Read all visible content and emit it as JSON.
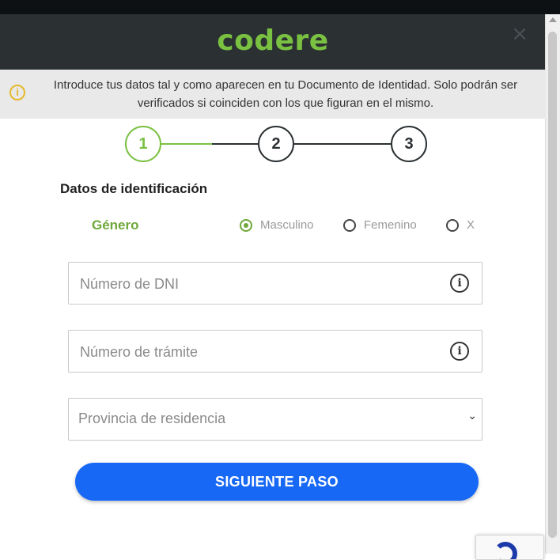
{
  "header": {
    "logo_text": "codere",
    "close_glyph": "×",
    "colors": {
      "background": "#2b3033",
      "brand": "#7ac142"
    }
  },
  "notice": {
    "icon": "info-warning-icon",
    "text": "Introduce tus datos tal y como aparecen en tu Documento de Identidad. Solo podrán ser verificados si coinciden con los que figuran en el mismo."
  },
  "stepper": {
    "steps": [
      {
        "label": "1",
        "active": true
      },
      {
        "label": "2",
        "active": false
      },
      {
        "label": "3",
        "active": false
      }
    ]
  },
  "form": {
    "section_title": "Datos de identificación",
    "gender": {
      "label": "Género",
      "options": [
        {
          "label": "Masculino",
          "selected": true
        },
        {
          "label": "Femenino",
          "selected": false
        },
        {
          "label": "X",
          "selected": false
        }
      ]
    },
    "dni": {
      "placeholder": "Número de DNI",
      "value": ""
    },
    "tramite": {
      "placeholder": "Número de trámite",
      "value": ""
    },
    "province": {
      "placeholder": "Provincia de residencia"
    },
    "submit_label": "SIGUIENTE PASO",
    "submit_color": "#1668f5"
  }
}
